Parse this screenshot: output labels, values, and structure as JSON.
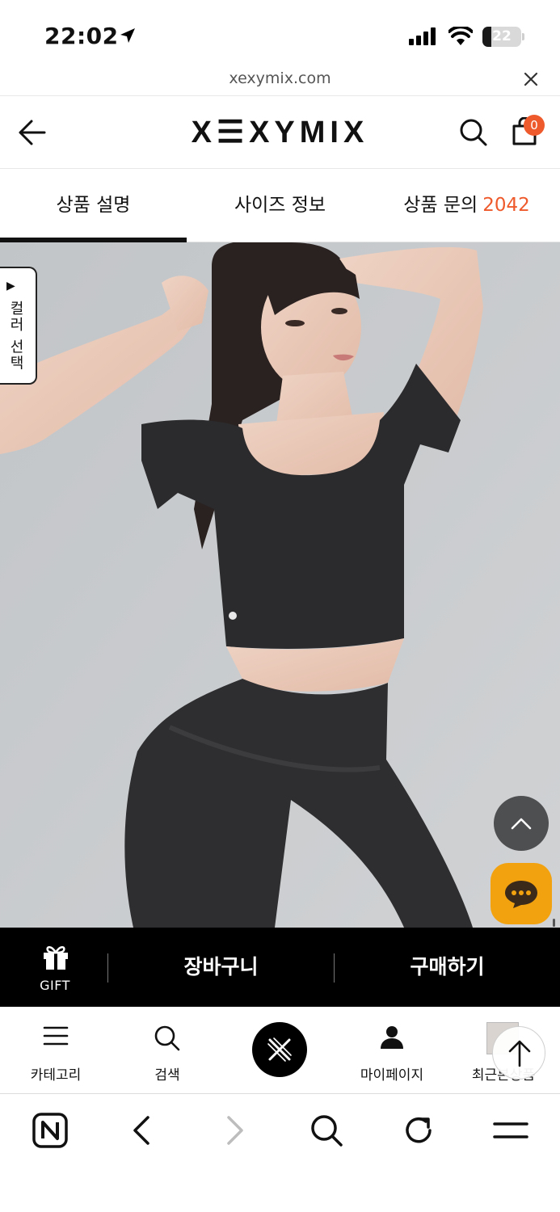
{
  "status_bar": {
    "time": "22:02",
    "battery": "22",
    "battery_level": 0.22,
    "icons": [
      "location-arrow-icon",
      "signal-icon",
      "wifi-icon",
      "battery-icon"
    ]
  },
  "browser": {
    "url": "xexymix.com",
    "close_icon": "close-icon"
  },
  "header": {
    "logo": "X☰XYMIX",
    "cart_count": "0",
    "icons": [
      "back-arrow-icon",
      "search-icon",
      "shopping-bag-icon"
    ]
  },
  "tabs": [
    {
      "label": "상품 설명",
      "active": true
    },
    {
      "label": "사이즈 정보",
      "active": false
    },
    {
      "label": "상품 문의",
      "count": "2042",
      "active": false
    }
  ],
  "product": {
    "color_select": "컬러 선택",
    "color_select_arrow": "▶"
  },
  "purchase_bar": {
    "gift_label": "GIFT",
    "cart_label": "장바구니",
    "buy_label": "구매하기"
  },
  "bottom_nav": {
    "items": [
      {
        "label": "카테고리",
        "icon": "hamburger-menu-icon"
      },
      {
        "label": "검색",
        "icon": "search-icon"
      },
      {
        "label": "",
        "icon": "brand-home-icon"
      },
      {
        "label": "마이페이지",
        "icon": "user-icon"
      },
      {
        "label": "최근본상품",
        "icon": "recent-thumbnail"
      }
    ]
  },
  "browser_toolbar": {
    "icons": [
      "naver-n-icon",
      "back-icon",
      "forward-icon",
      "search-icon",
      "reload-icon",
      "menu-icon"
    ]
  },
  "colors": {
    "accent": "#ee5a2c",
    "chat_button": "#f2a20e",
    "purchase_bar": "#000000"
  }
}
